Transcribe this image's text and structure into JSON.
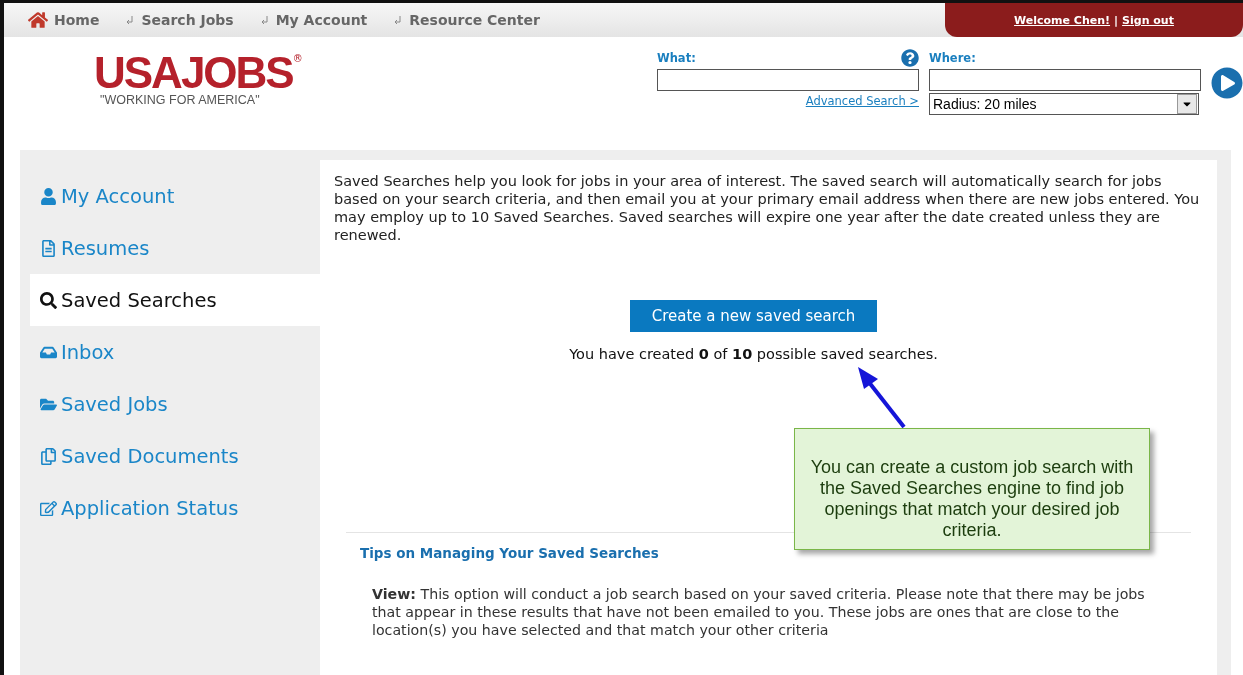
{
  "nav": {
    "items": [
      {
        "label": "Home",
        "kind": "home"
      },
      {
        "label": "Search Jobs",
        "kind": "link"
      },
      {
        "label": "My Account",
        "kind": "link"
      },
      {
        "label": "Resource Center",
        "kind": "link"
      }
    ],
    "welcome": "Welcome Chen!",
    "separator": "|",
    "sign_out": "Sign out"
  },
  "logo": {
    "name": "USAJOBS",
    "mark": "®",
    "tagline": "\"WORKING FOR AMERICA\""
  },
  "search": {
    "what_label": "What:",
    "where_label": "Where:",
    "advanced": "Advanced Search >",
    "radius": "Radius: 20 miles"
  },
  "sidebar": {
    "items": [
      {
        "label": "My Account",
        "selected": false
      },
      {
        "label": "Resumes",
        "selected": false
      },
      {
        "label": "Saved Searches",
        "selected": true
      },
      {
        "label": "Inbox",
        "selected": false
      },
      {
        "label": "Saved Jobs",
        "selected": false
      },
      {
        "label": "Saved Documents",
        "selected": false
      },
      {
        "label": "Application Status",
        "selected": false
      }
    ]
  },
  "content": {
    "intro": "Saved Searches help you look for jobs in your area of interest. The saved search will automatically search for jobs based on your search criteria, and then email you at your primary email address when there are new jobs entered. You may employ up to 10 Saved Searches. Saved searches will expire one year after the date created unless they are renewed.",
    "create_button": "Create a new saved search",
    "count": "You have created **0** of **10** possible saved searches.",
    "tips_title": "Tips on Managing Your Saved Searches",
    "tips": [
      "**View:** This option will conduct a job search based on your saved criteria. Please note that there may be jobs that appear in these results that have not been emailed to you. These jobs are ones that are close to the location(s) you have selected and that match your other criteria"
    ]
  },
  "callout": {
    "text": "You can create a custom job search with the Saved Searches engine to find job openings that match your desired job criteria."
  }
}
